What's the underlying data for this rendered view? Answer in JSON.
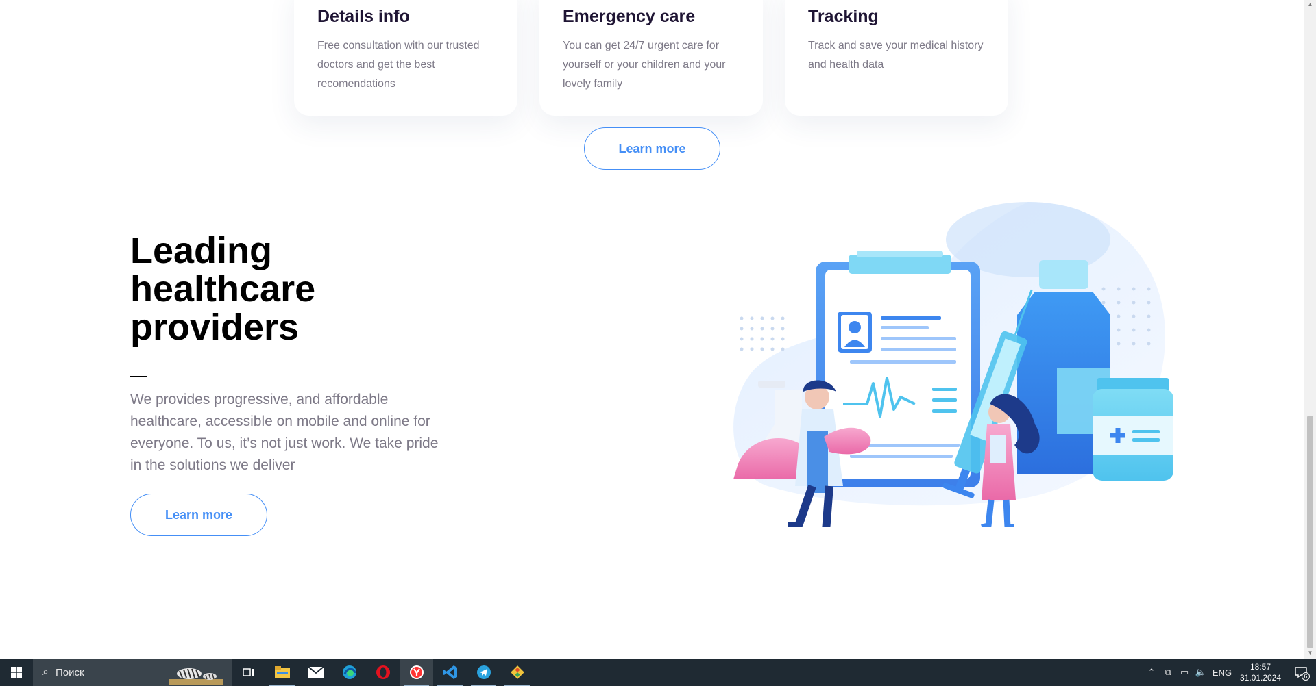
{
  "cards": [
    {
      "title": "Details info",
      "text": "Free consultation with our trusted doctors and get the best recomendations"
    },
    {
      "title": "Emergency care",
      "text": "You can get 24/7 urgent care for yourself or your children and your lovely family"
    },
    {
      "title": "Tracking",
      "text": "Track and save your medical history and health data"
    }
  ],
  "services_button": "Learn more",
  "hero": {
    "title": "Leading healthcare providers",
    "text": "We provides progressive, and affordable healthcare, accessible on mobile and online for everyone. To us, it’s not just work. We take pride in the solutions we deliver",
    "button": "Learn more"
  },
  "colors": {
    "accent": "#458ff6",
    "text_gray": "#7d7987",
    "heading": "#1f1534",
    "taskbar": "#1f2a33"
  },
  "taskbar": {
    "search_placeholder": "Поиск",
    "apps": [
      "file-explorer-icon",
      "mail-icon",
      "edge-icon",
      "opera-icon",
      "yandex-browser-icon",
      "vscode-icon",
      "telegram-icon",
      "git-icon"
    ],
    "language": "ENG",
    "time": "18:57",
    "date": "31.01.2024",
    "notification_count": "6"
  }
}
